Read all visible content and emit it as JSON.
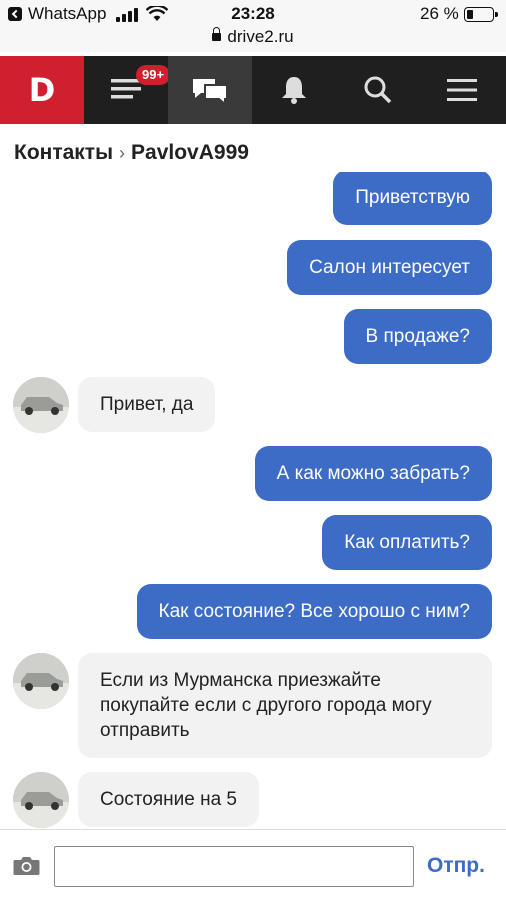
{
  "status_bar": {
    "back_app": "WhatsApp",
    "time": "23:28",
    "battery_percent_label": "26 %",
    "battery_level": 0.26,
    "url": "drive2.ru"
  },
  "nav": {
    "logo": "D",
    "badge": "99+",
    "icons": [
      "logo-icon",
      "feed-icon",
      "messages-icon",
      "bell-icon",
      "search-icon",
      "menu-icon"
    ],
    "accent": "#d01f2e"
  },
  "breadcrumb": {
    "parent": "Контакты",
    "separator": "›",
    "current": "PavlovA999"
  },
  "messages": [
    {
      "dir": "out",
      "text": "Приветствую"
    },
    {
      "dir": "out",
      "text": "Салон интересует"
    },
    {
      "dir": "out",
      "text": "В продаже?"
    },
    {
      "dir": "in",
      "text": "Привет, да"
    },
    {
      "dir": "out",
      "text": "А как можно забрать?"
    },
    {
      "dir": "out",
      "text": "Как оплатить?"
    },
    {
      "dir": "out",
      "text": "Как состояние? Все хорошо с ним?"
    },
    {
      "dir": "in",
      "lines": [
        "Если из Мурманска приезжайте",
        "покупайте если с другого города могу",
        "отправить"
      ]
    },
    {
      "dir": "in",
      "text": "Состояние на 5"
    }
  ],
  "composer": {
    "placeholder": "",
    "send_label": "Отпр."
  },
  "colors": {
    "outgoing_bubble": "#3d6cc6",
    "incoming_bubble": "#f2f2f2"
  }
}
